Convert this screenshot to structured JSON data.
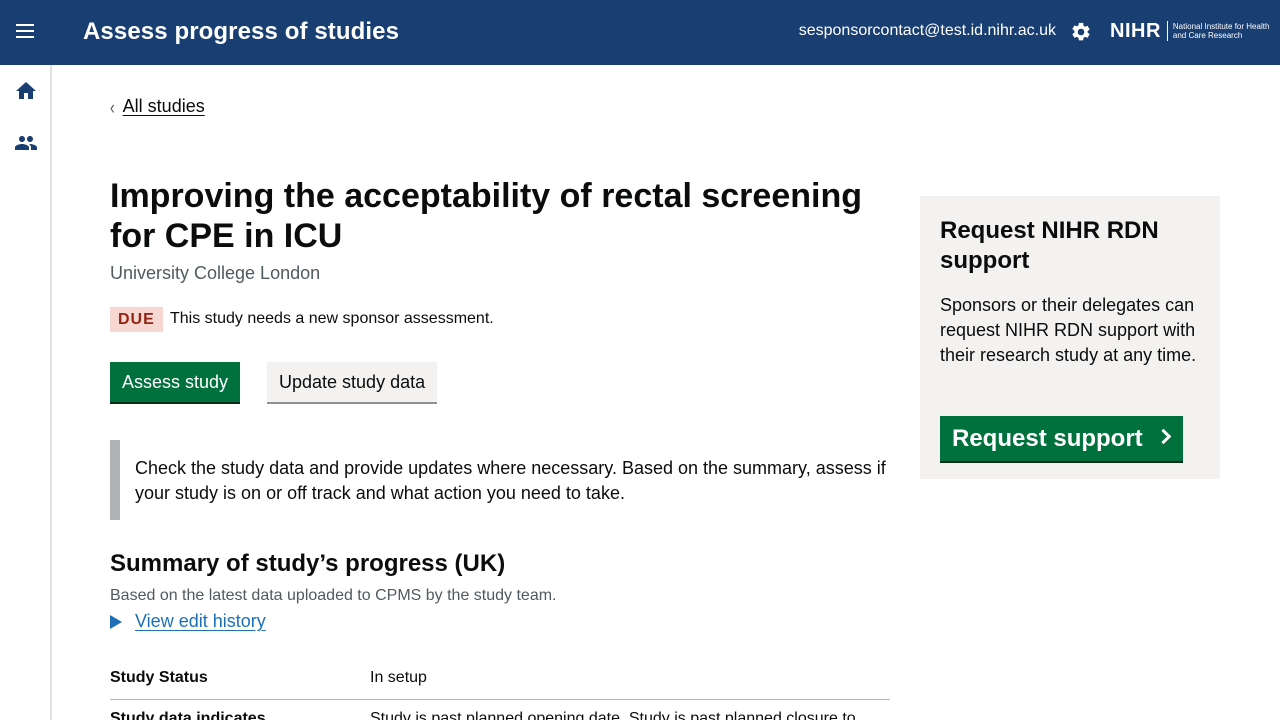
{
  "header": {
    "title": "Assess progress of studies",
    "user_email": "sesponsorcontact@test.id.nihr.ac.uk",
    "logo_text": "NIHR",
    "logo_subtext": "National Institute for Health and Care Research",
    "background": "#193e72"
  },
  "sidebar": {
    "items": [
      {
        "icon": "home-icon"
      },
      {
        "icon": "people-icon"
      }
    ]
  },
  "nav": {
    "back_label": "All studies"
  },
  "study": {
    "title": "Improving the acceptability of rectal screening for CPE in ICU",
    "organisation": "University College London",
    "status_tag": "DUE",
    "status_message": "This study needs a new sponsor assessment."
  },
  "actions": {
    "assess_label": "Assess study",
    "update_label": "Update study data"
  },
  "inset_text": "Check the study data and provide updates where necessary. Based on the summary, assess if your study is on or off track and what action you need to take.",
  "summary": {
    "heading": "Summary of study’s progress (UK)",
    "subheading": "Based on the latest data uploaded to CPMS by the study team.",
    "history_link": "View edit history",
    "rows": [
      {
        "key": "Study Status",
        "value": "In setup"
      },
      {
        "key": "Study data indicates",
        "value": "Study is past planned opening date. Study is past planned closure to"
      }
    ]
  },
  "side_panel": {
    "heading": "Request NIHR RDN support",
    "body": "Sponsors or their delegates can request NIHR RDN support with their research study at any time.",
    "button_label": "Request support"
  },
  "colors": {
    "primary_green": "#00703c",
    "link_blue": "#1d70b8",
    "due_bg": "#f6d7d2",
    "due_text": "#942514"
  }
}
